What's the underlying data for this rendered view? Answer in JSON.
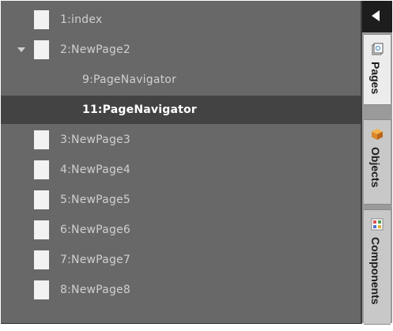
{
  "tree": {
    "items": [
      {
        "label": "1:index",
        "kind": "page",
        "expanded": false,
        "selected": false
      },
      {
        "label": "2:NewPage2",
        "kind": "page",
        "expanded": true,
        "selected": false
      },
      {
        "label": "9:PageNavigator",
        "kind": "child",
        "selected": false
      },
      {
        "label": "11:PageNavigator",
        "kind": "child",
        "selected": true
      },
      {
        "label": "3:NewPage3",
        "kind": "page",
        "expanded": false,
        "selected": false
      },
      {
        "label": "4:NewPage4",
        "kind": "page",
        "expanded": false,
        "selected": false
      },
      {
        "label": "5:NewPage5",
        "kind": "page",
        "expanded": false,
        "selected": false
      },
      {
        "label": "6:NewPage6",
        "kind": "page",
        "expanded": false,
        "selected": false
      },
      {
        "label": "7:NewPage7",
        "kind": "page",
        "expanded": false,
        "selected": false
      },
      {
        "label": "8:NewPage8",
        "kind": "page",
        "expanded": false,
        "selected": false
      }
    ]
  },
  "side_tabs": {
    "collapse_icon": "collapse-left-icon",
    "pages": {
      "label": "Pages",
      "icon": "pages-icon",
      "active": true
    },
    "objects": {
      "label": "Objects",
      "icon": "cube-icon",
      "active": false
    },
    "components": {
      "label": "Components",
      "icon": "components-grid-icon",
      "active": false
    }
  },
  "colors": {
    "panel_bg": "#686868",
    "selected_row_bg": "#434343",
    "rail_bg": "#9a9a9a",
    "collapse_bg": "#1d1d1d"
  }
}
